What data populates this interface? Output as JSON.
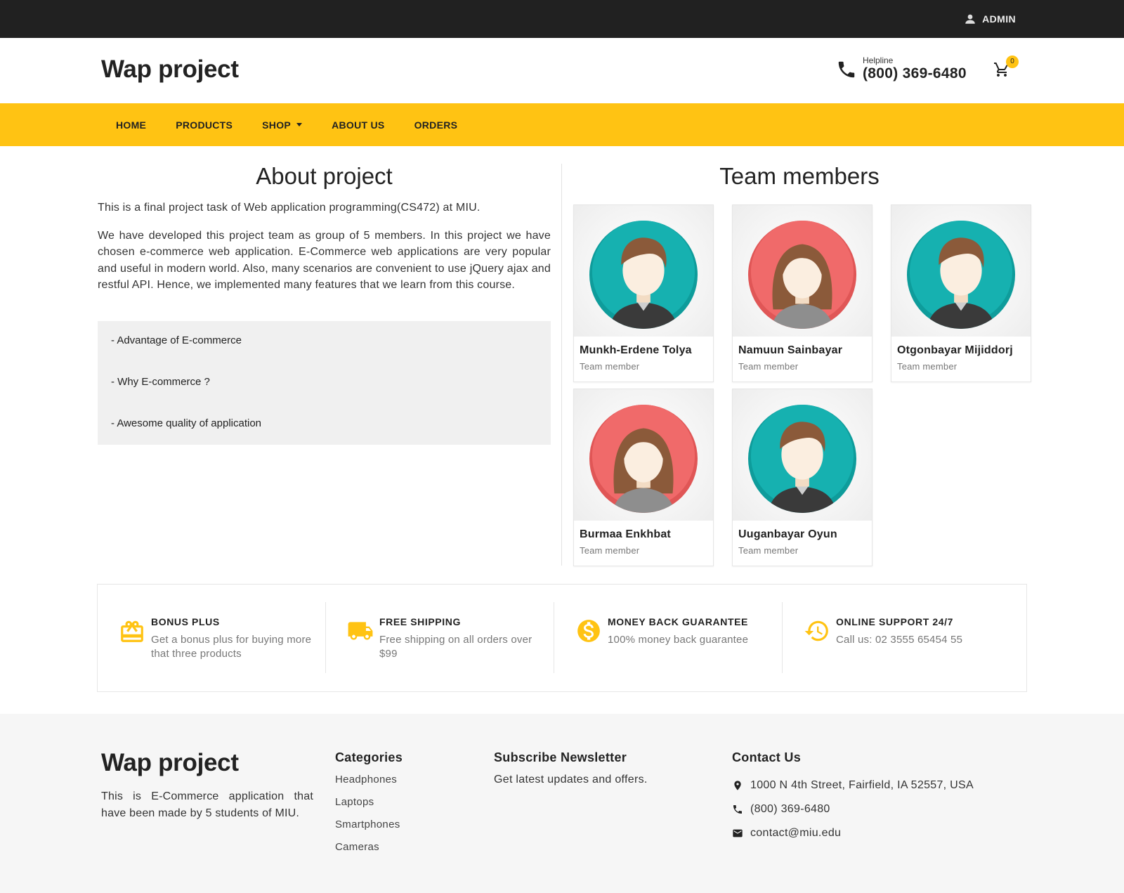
{
  "topbar": {
    "admin_label": "ADMIN",
    "icon": "person-icon"
  },
  "header": {
    "logo": "Wap project",
    "helpline_label": "Helpline",
    "helpline_phone": "(800) 369-6480",
    "cart_count": "0"
  },
  "nav": {
    "items": [
      "HOME",
      "PRODUCTS",
      "SHOP",
      "ABOUT US",
      "ORDERS"
    ]
  },
  "about": {
    "title": "About project",
    "p1": "This is a final project task of Web application programming(CS472) at MIU.",
    "p2": "We have developed this project team as group of 5 members. In this project we have chosen e-commerce web application. E-Commerce web applications are very popular and useful in modern world. Also, many scenarios are convenient to use jQuery ajax and restful API. Hence, we implemented many features that we learn from this course.",
    "faq": [
      "- Advantage of E-commerce",
      "- Why E-commerce ?",
      "- Awesome quality of application"
    ]
  },
  "team": {
    "title": "Team members",
    "members": [
      {
        "name": "Munkh-Erdene Tolya",
        "role": "Team member"
      },
      {
        "name": "Namuun Sainbayar",
        "role": "Team member"
      },
      {
        "name": "Otgonbayar Mijiddorj",
        "role": "Team member"
      },
      {
        "name": "Burmaa Enkhbat",
        "role": "Team member"
      },
      {
        "name": "Uuganbayar Oyun",
        "role": "Team member"
      }
    ]
  },
  "features": [
    {
      "title": "BONUS PLUS",
      "desc": "Get a bonus plus for buying more that three products",
      "icon": "gift-icon"
    },
    {
      "title": "FREE SHIPPING",
      "desc": "Free shipping on all orders over $99",
      "icon": "truck-icon"
    },
    {
      "title": "MONEY BACK GUARANTEE",
      "desc": "100% money back guarantee",
      "icon": "dollar-icon"
    },
    {
      "title": "ONLINE SUPPORT 24/7",
      "desc": "Call us: 02 3555 65454 55",
      "icon": "history-icon"
    }
  ],
  "footer": {
    "logo": "Wap project",
    "desc": "This is E-Commerce application that have been made by 5 students of MIU.",
    "categories_title": "Categories",
    "categories": [
      "Headphones",
      "Laptops",
      "Smartphones",
      "Cameras"
    ],
    "newsletter_title": "Subscribe Newsletter",
    "newsletter_text": "Get latest updates and offers.",
    "contact_title": "Contact Us",
    "address": "1000 N 4th Street, Fairfield, IA 52557, USA",
    "phone": "(800) 369-6480",
    "email": "contact@miu.edu"
  },
  "colors": {
    "accent": "#ffc313",
    "topbar": "#212121",
    "footer_bg": "#f6f6f6",
    "avatar_teal": "#16b1b0",
    "avatar_red": "#f06a6a"
  }
}
